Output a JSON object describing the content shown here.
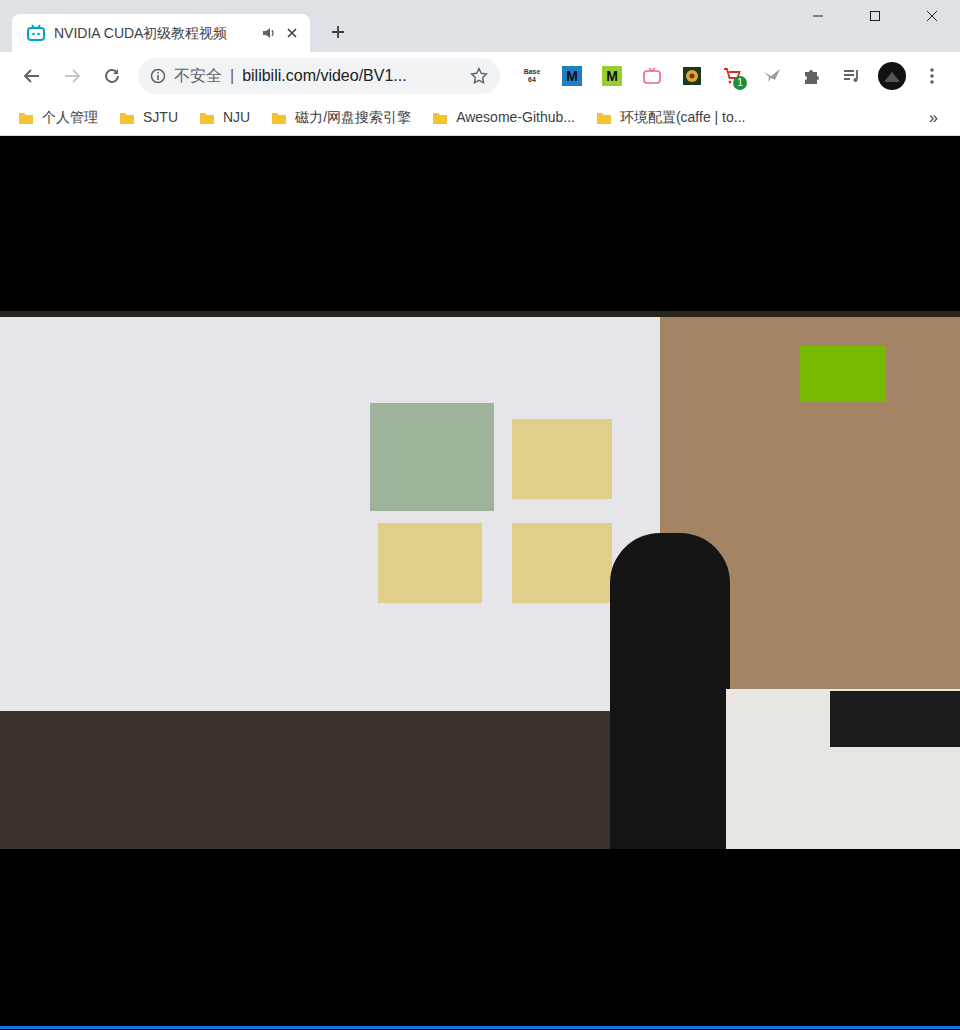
{
  "window": {
    "title": "NVIDIA CUDA初级教程视频"
  },
  "tabs": [
    {
      "label": "NVIDIA CUDA初级教程视频",
      "selected": true,
      "playing_audio": true
    }
  ],
  "toolbar": {
    "back_enabled": true,
    "forward_enabled": false,
    "security_label": "不安全",
    "separator": "|",
    "url": "bilibili.com/video/BV1...",
    "bookmarked": false
  },
  "extensions": [
    {
      "kind": "base64",
      "lines": [
        "Base",
        "64"
      ]
    },
    {
      "kind": "letter",
      "text": "M",
      "color": "#1f7fc2"
    },
    {
      "kind": "letter",
      "text": "M",
      "color": "#9acd32"
    },
    {
      "kind": "tv",
      "color": "#f06292"
    },
    {
      "kind": "flower",
      "color": "#e9a23b"
    },
    {
      "kind": "cart",
      "badge": "1",
      "color": "#d93025"
    },
    {
      "kind": "bird",
      "color": "#9aa0a6"
    },
    {
      "kind": "puzzle",
      "color": "#5f6368"
    },
    {
      "kind": "playlist",
      "color": "#5f6368"
    }
  ],
  "bookmarks": [
    {
      "label": "个人管理"
    },
    {
      "label": "SJTU"
    },
    {
      "label": "NJU"
    },
    {
      "label": "磁力/网盘搜索引擎"
    },
    {
      "label": "Awesome-Github..."
    },
    {
      "label": "环境配置(caffe | to..."
    }
  ],
  "bookmarks_overflow": "»"
}
